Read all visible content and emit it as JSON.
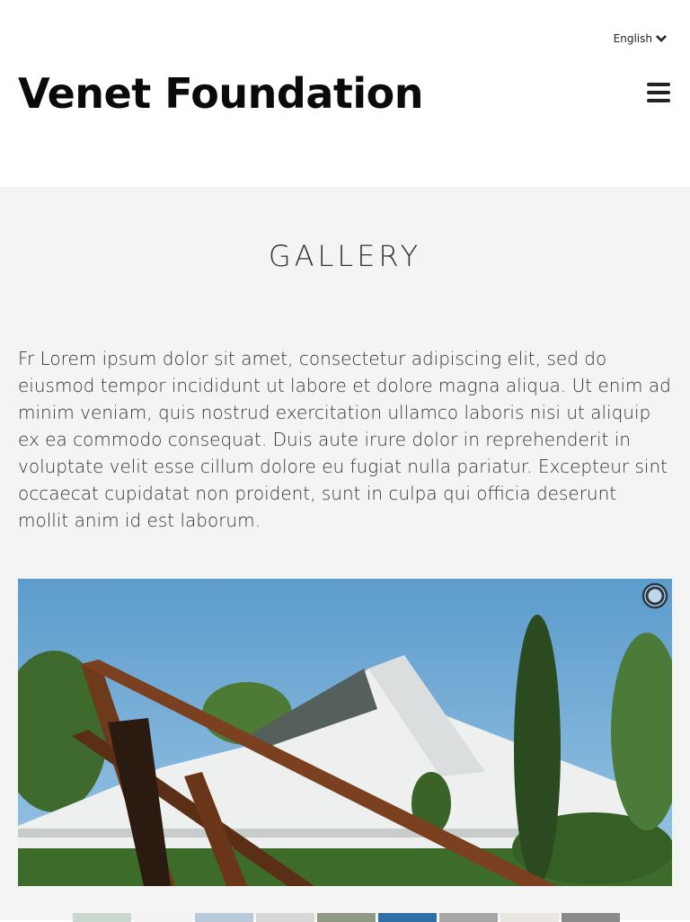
{
  "header": {
    "language": "English",
    "brand": "Venet Foundation"
  },
  "main": {
    "title": "GALLERY",
    "intro": "Fr Lorem ipsum dolor sit amet, consectetur adipiscing elit, sed do eiusmod tempor incididunt ut labore et dolore magna aliqua. Ut enim ad minim veniam, quis nostrud exercitation ullamco laboris nisi ut aliquip ex ea commodo consequat. Duis aute irure dolor in reprehenderit in voluptate velit esse cillum dolore eu fugiat nulla pariatur. Excepteur sint occaecat cupidatat non proident, sunt in culpa qui officia deserunt mollit anim id est laborum."
  },
  "icons": {
    "language_toggle": "chevron-down-icon",
    "menu": "hamburger-menu-icon",
    "slideshow_status": "loading-spinner-icon"
  },
  "colors": {
    "page_background": "#f4f4f4",
    "header_background": "#ffffff",
    "brand_text": "#0a0a0a"
  },
  "thumbnails": [
    {
      "label": "thumbnail-1",
      "color": "#c9d7cf"
    },
    {
      "label": "thumbnail-2",
      "color": "#f2f2f2"
    },
    {
      "label": "thumbnail-3",
      "color": "#b9c9d9"
    },
    {
      "label": "thumbnail-4",
      "color": "#d7d7d7"
    },
    {
      "label": "thumbnail-5",
      "color": "#8e9a86"
    },
    {
      "label": "thumbnail-6",
      "color": "#2f6fa8"
    },
    {
      "label": "thumbnail-7",
      "color": "#a7a7a7"
    },
    {
      "label": "thumbnail-8",
      "color": "#e9e6e1"
    },
    {
      "label": "thumbnail-9",
      "color": "#8a8a8a"
    }
  ]
}
